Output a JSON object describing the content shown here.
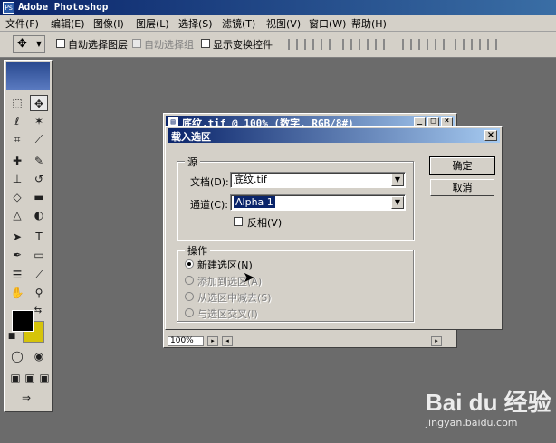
{
  "app": {
    "title": "Adobe Photoshop"
  },
  "menu": [
    "文件(F)",
    "编辑(E)",
    "图像(I)",
    "图层(L)",
    "选择(S)",
    "滤镜(T)",
    "视图(V)",
    "窗口(W)",
    "帮助(H)"
  ],
  "options": {
    "auto_select_layer": "自动选择图层",
    "auto_select_group": "自动选择组",
    "show_transform": "显示变换控件"
  },
  "document": {
    "title": "底纹.tif @ 100% (数字, RGB/8#)",
    "zoom": "100%"
  },
  "dialog": {
    "title": "载入选区",
    "source_group": "源",
    "doc_label": "文档(D):",
    "doc_value": "底纹.tif",
    "channel_label": "通道(C):",
    "channel_value": "Alpha 1",
    "invert_label": "反相(V)",
    "ok": "确定",
    "cancel": "取消",
    "operation_group": "操作",
    "ops": [
      "新建选区(N)",
      "添加到选区(A)",
      "从选区中减去(S)",
      "与选区交叉(I)"
    ]
  },
  "watermark": {
    "main": "Bai du 经验",
    "sub": "jingyan.baidu.com"
  },
  "colors": {
    "foreground": "#000000",
    "background": "#d6c40a",
    "title_active": "#0a246a"
  }
}
